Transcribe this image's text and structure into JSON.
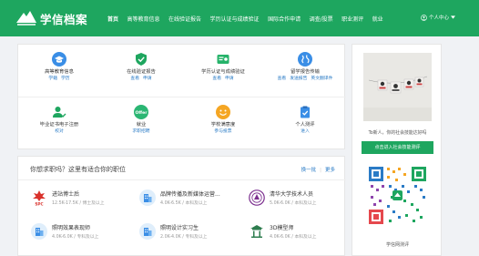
{
  "header": {
    "logo_text": "学信档案",
    "nav": [
      "首页",
      "高等教育信息",
      "在线验证报告",
      "学历认证与成绩验证",
      "国际合作申请",
      "调查/投票",
      "职业测评",
      "就业"
    ],
    "user_menu": "个人中心"
  },
  "services": [
    {
      "title": "高等教育信息",
      "links": [
        "学籍",
        "学历"
      ],
      "icon": "graduate-icon",
      "color": "#3a8ee6"
    },
    {
      "title": "在线验证报告",
      "links": [
        "查看",
        "申请"
      ],
      "icon": "shield-check-icon",
      "color": "#1ea65f"
    },
    {
      "title": "学历认证与成绩验证",
      "links": [
        "查看",
        "申请"
      ],
      "icon": "certificate-icon",
      "color": "#26b36a"
    },
    {
      "title": "留学报告传输",
      "links": [
        "查看",
        "发送报告",
        "英文翻译件"
      ],
      "icon": "globe-icon",
      "color": "#3a8ee6"
    },
    {
      "title": "毕业证书电子注册",
      "links": [
        "校对"
      ],
      "icon": "user-check-icon",
      "color": "#1ea65f"
    },
    {
      "title": "就业",
      "links": [
        "求职招聘"
      ],
      "icon": "offer-icon",
      "color": "#2bb673"
    },
    {
      "title": "学校满意度",
      "links": [
        "参与投票"
      ],
      "icon": "smile-icon",
      "color": "#f5a623"
    },
    {
      "title": "个人测评",
      "links": [
        "进入"
      ],
      "icon": "clipboard-icon",
      "color": "#3a8ee6"
    }
  ],
  "jobs": {
    "title": "你想求职吗？这里有适合你的职位",
    "refresh": "换一批",
    "more": "更多",
    "items": [
      {
        "name": "进站博士后",
        "meta": "12.5K-17.5K  /  博士及以上",
        "logo": "spc-logo"
      },
      {
        "name": "品牌传播及新媒体运营...",
        "meta": "4.0K-6.5K  /  本科及以上",
        "logo": "building-icon"
      },
      {
        "name": "清华大学技术人员",
        "meta": "5.0K-6.0K  /  本科及以上",
        "logo": "tsinghua-logo"
      },
      {
        "name": "照明效果表现师",
        "meta": "4.0K-6.0K  /  专科及以上",
        "logo": "building-icon"
      },
      {
        "name": "照明设计实习生",
        "meta": "2.0K-4.0K  /  专科及以上",
        "logo": "building-icon"
      },
      {
        "name": "3D模型师",
        "meta": "4.0K-6.0K  /  本科及以上",
        "logo": "pavilion-logo"
      }
    ]
  },
  "side": {
    "caption": "To新人，你的社会技能达好吗",
    "button": "点击进入社会技能测评",
    "qr_caption": "学信网测评"
  }
}
